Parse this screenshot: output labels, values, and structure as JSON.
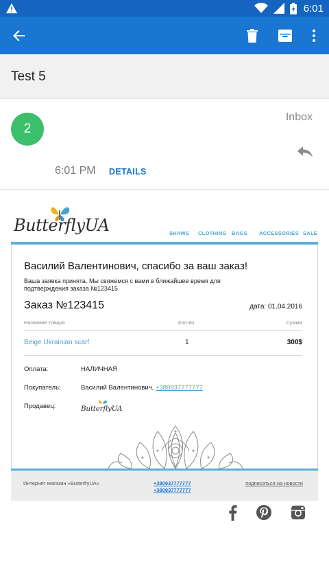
{
  "status_bar": {
    "time": "6:01"
  },
  "email": {
    "subject": "Test 5",
    "avatar_letter": "2",
    "folder": "Inbox",
    "time": "6:01 PM",
    "details_label": "DETAILS"
  },
  "newsletter": {
    "logo_text": "ButterflyUA",
    "nav": [
      "SHAWS",
      "CLOTHING",
      "BAGS",
      "ACCESSORIES",
      "SALE"
    ],
    "greeting": "Василий Валентинович, спасибо за ваш заказ!",
    "sub": "Ваша заявка принята. Мы свяжемся с вами в ближайшее время для подтверждения заказа №123415",
    "order_title": "Заказ №123415",
    "order_date": "дата: 01.04.2016",
    "table": {
      "headers": [
        "Название товара",
        "Кол-во",
        "Сумма"
      ],
      "rows": [
        {
          "name": "Beige Ukrainian scarf",
          "qty": "1",
          "sum": "300$"
        }
      ]
    },
    "payment_label": "Оплата:",
    "payment_value": "НАЛИЧНАЯ",
    "buyer_label": "Покупатель:",
    "buyer_name": "Василий Валентинович,",
    "buyer_phone": "+380937777777",
    "seller_label": "Продавец:",
    "seller_logo_text": "ButterflyUA",
    "footer": {
      "shop": "Интернет магазин «ButterflyUA»",
      "phone1": "+380937777777",
      "phone2": "+380937777777",
      "subscribe": "подписаться на новости"
    }
  },
  "colors": {
    "appbar": "#1976d2",
    "statusbar": "#1565c0",
    "avatar": "#3cbf6a",
    "accent": "#5aaed5"
  },
  "icons": [
    "warning-icon",
    "wifi-icon",
    "signal-icon",
    "battery-icon",
    "back-arrow-icon",
    "delete-icon",
    "archive-icon",
    "more-vert-icon",
    "reply-icon",
    "facebook-icon",
    "pinterest-icon",
    "instagram-icon"
  ]
}
